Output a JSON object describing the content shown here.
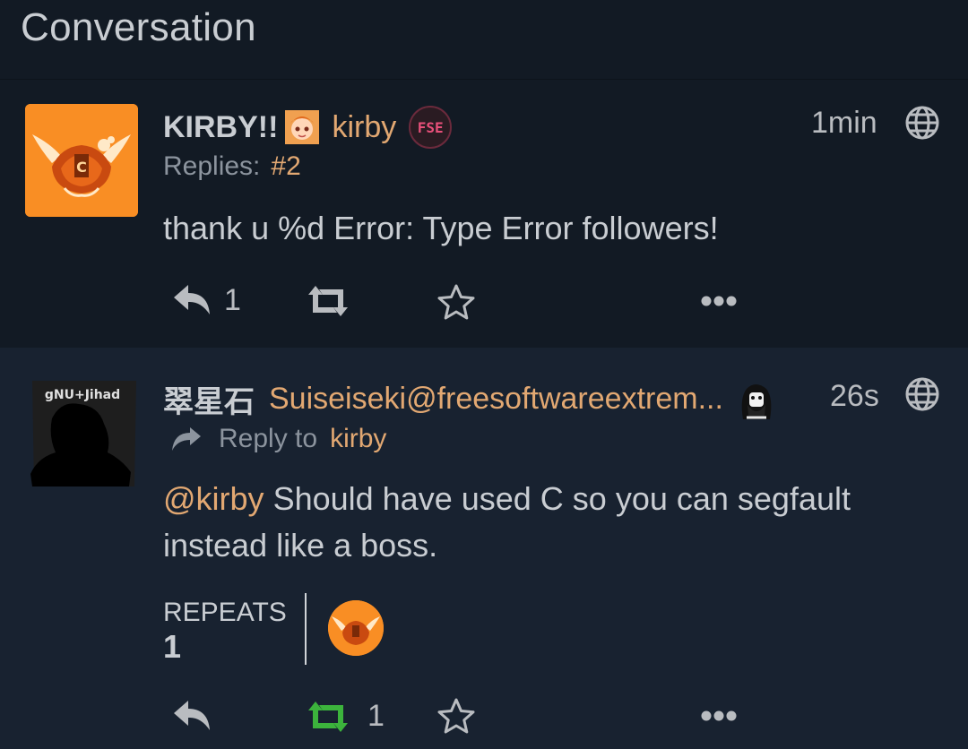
{
  "header": {
    "title": "Conversation"
  },
  "posts": [
    {
      "display_name": "KIRBY!!",
      "handle": "kirby",
      "instance_badge": "FSE",
      "replies_label": "Replies:",
      "replies_value": "#2",
      "time": "1min",
      "content": "thank u %d Error: Type Error followers!",
      "reply_count": "1"
    },
    {
      "display_name": "翠星石",
      "handle": "Suiseiseki@freesoftwareextrem...",
      "avatar_text": "gNU+Jihad",
      "reply_to_label": "Reply to",
      "reply_to_user": "kirby",
      "time": "26s",
      "mention": "@kirby",
      "content_line1": " Should have used C so you can segfault",
      "content_line2": "instead like a boss.",
      "repeats_label": "REPEATS",
      "repeats_count": "1",
      "repeat_count": "1"
    }
  ],
  "colors": {
    "accent": "#e2a872",
    "repeat_active": "#3cb43c",
    "icon": "#b9bcc0"
  },
  "icons": [
    "globe-icon",
    "reply-icon",
    "retweet-icon",
    "star-icon",
    "ellipsis-icon",
    "reply-arrow-icon"
  ]
}
